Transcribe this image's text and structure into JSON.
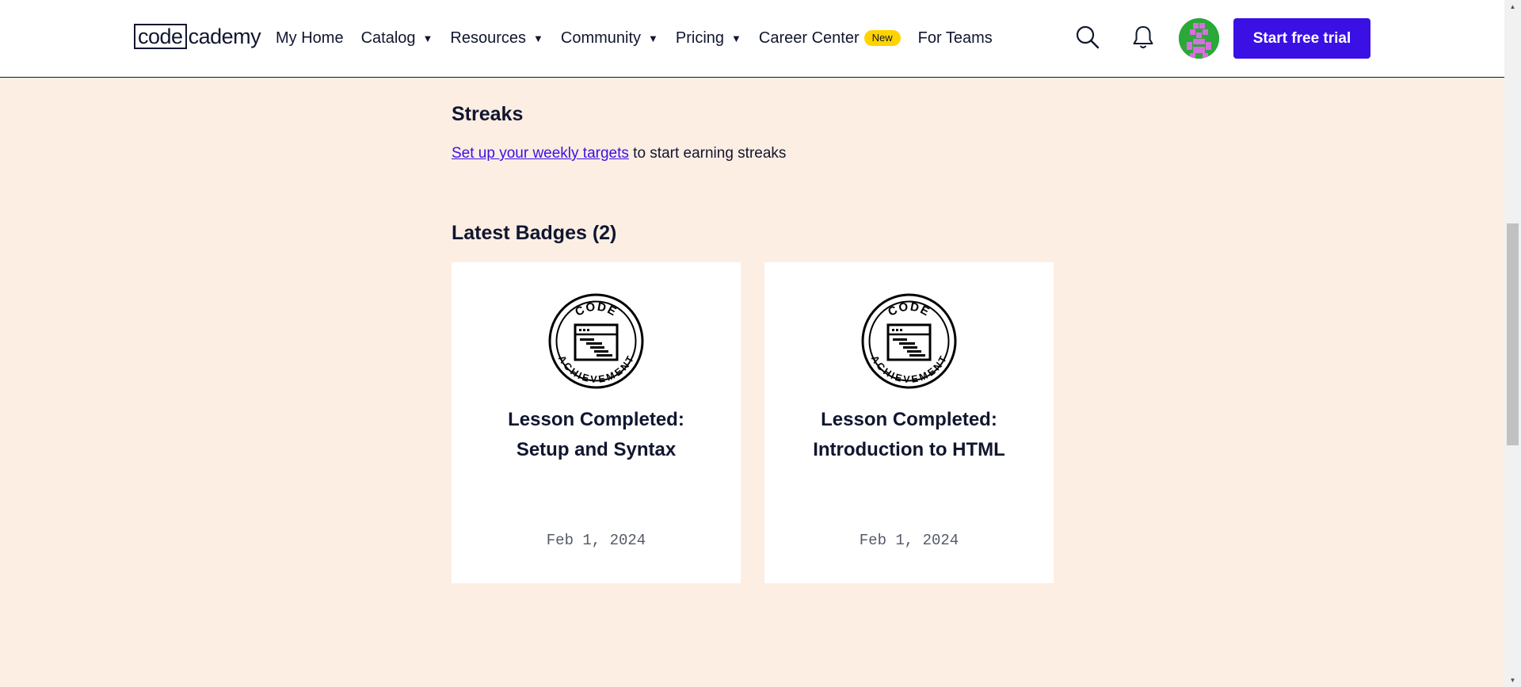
{
  "header": {
    "logo": {
      "part1": "code",
      "part2": "cademy"
    },
    "nav": [
      {
        "label": "My Home",
        "dropdown": false
      },
      {
        "label": "Catalog",
        "dropdown": true
      },
      {
        "label": "Resources",
        "dropdown": true
      },
      {
        "label": "Community",
        "dropdown": true
      },
      {
        "label": "Pricing",
        "dropdown": true
      },
      {
        "label": "Career Center",
        "dropdown": false,
        "badge": "New"
      },
      {
        "label": "For Teams",
        "dropdown": false
      }
    ],
    "icons": {
      "search": "search-icon",
      "notifications": "bell-icon",
      "avatar": "avatar"
    },
    "cta_label": "Start free trial",
    "cta_color": "#3A10E5"
  },
  "streaks": {
    "title": "Streaks",
    "link_text": "Set up your weekly targets",
    "suffix_text": " to start earning streaks"
  },
  "badges": {
    "title": "Latest Badges (2)",
    "items": [
      {
        "line1": "Lesson Completed:",
        "line2": "Setup and Syntax",
        "date": "Feb 1, 2024"
      },
      {
        "line1": "Lesson Completed:",
        "line2": "Introduction to HTML",
        "date": "Feb 1, 2024"
      }
    ],
    "badge_icon_text_top": "CODE",
    "badge_icon_text_bottom": "ACHIEVEMENT"
  },
  "colors": {
    "background": "#FDEEE3",
    "navy": "#10162F",
    "accent": "#3A10E5",
    "new_badge": "#FFD300"
  }
}
